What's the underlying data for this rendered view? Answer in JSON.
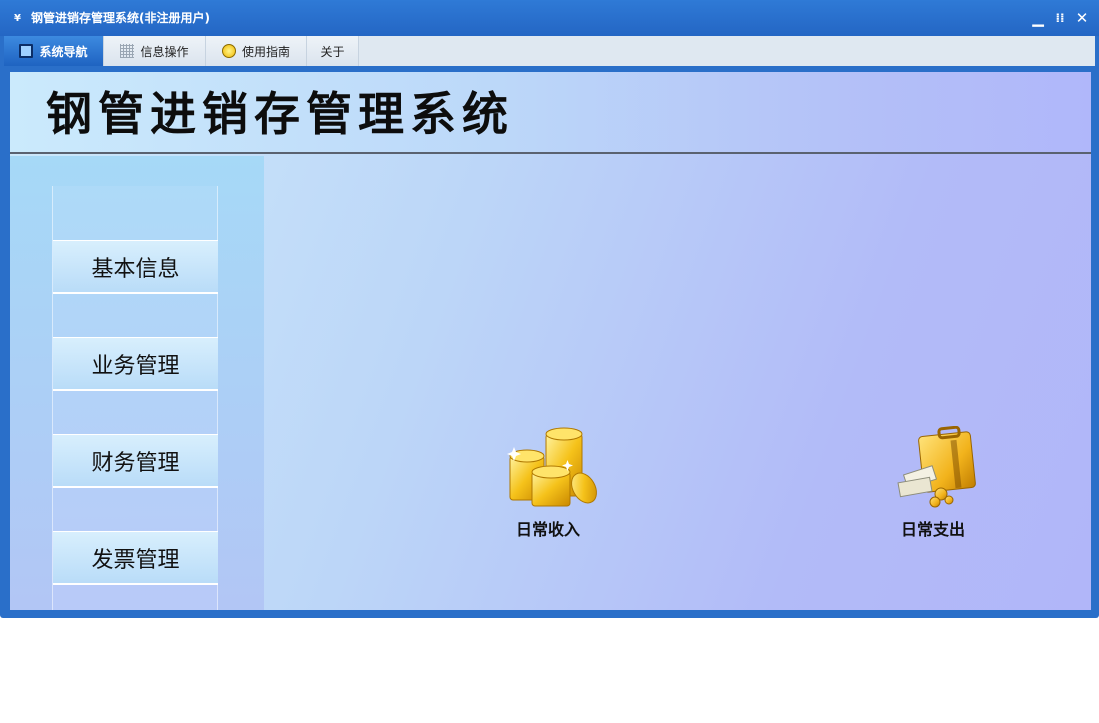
{
  "window": {
    "title": "钢管进销存管理系统(非注册用户)",
    "controls": {
      "minimize": "▁",
      "restore": "⁞⁞",
      "close": "✕"
    }
  },
  "tabs": [
    {
      "label": "系统导航",
      "icon": "monitor-icon",
      "active": true
    },
    {
      "label": "信息操作",
      "icon": "grid-icon",
      "active": false
    },
    {
      "label": "使用指南",
      "icon": "bulb-icon",
      "active": false
    },
    {
      "label": "关于",
      "icon": "",
      "active": false
    }
  ],
  "header": {
    "app_title": "钢管进销存管理系统"
  },
  "sidebar": {
    "items": [
      {
        "label": "基本信息"
      },
      {
        "label": "业务管理"
      },
      {
        "label": "财务管理"
      },
      {
        "label": "发票管理"
      }
    ]
  },
  "main": {
    "shortcuts": [
      {
        "label": "日常收入",
        "icon": "gold-coins-icon"
      },
      {
        "label": "日常支出",
        "icon": "money-briefcase-icon"
      }
    ]
  },
  "colors": {
    "titlebar": "#2466c4",
    "active_tab": "#1f63c1",
    "tabbar": "#dfe8f1",
    "gold": "#f1b800"
  }
}
